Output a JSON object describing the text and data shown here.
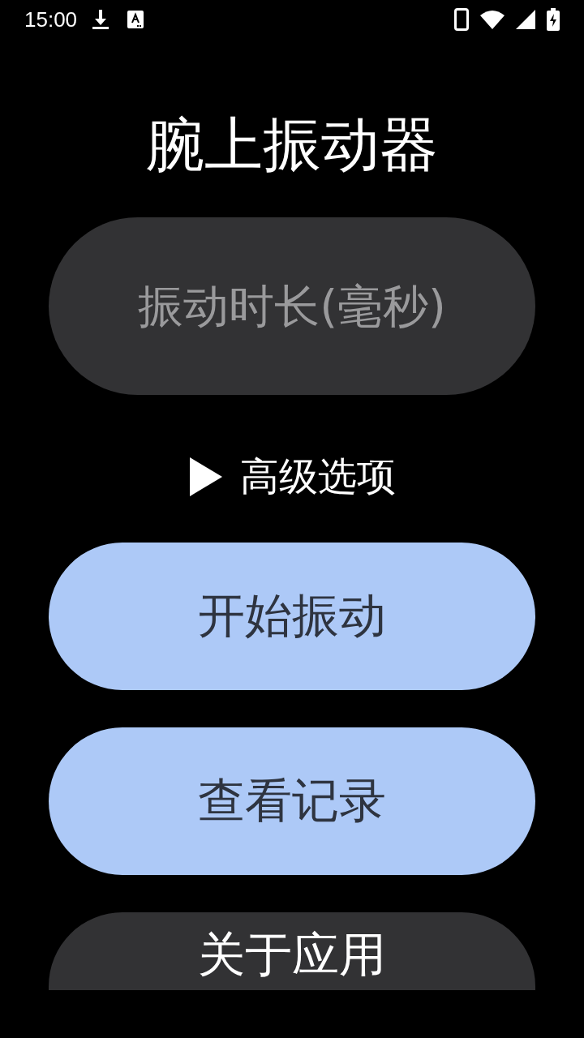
{
  "status_bar": {
    "time": "15:00"
  },
  "title": "腕上振动器",
  "duration_field": {
    "placeholder": "振动时长(毫秒)"
  },
  "advanced": {
    "label": "高级选项",
    "expanded": false
  },
  "buttons": [
    {
      "label": "开始振动",
      "kind": "primary"
    },
    {
      "label": "查看记录",
      "kind": "primary"
    },
    {
      "label": "关于应用",
      "kind": "secondary"
    }
  ]
}
